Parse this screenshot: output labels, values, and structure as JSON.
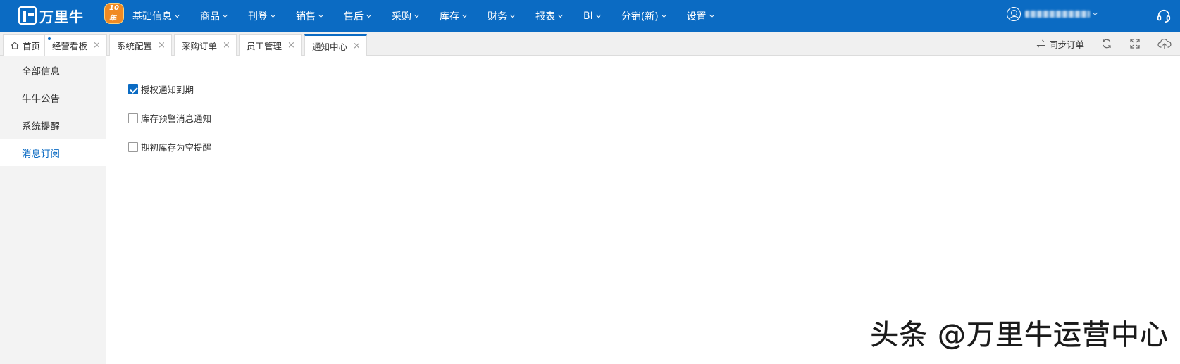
{
  "header": {
    "logo_text": "万里牛",
    "anniversary_badge": "10年",
    "nav": [
      {
        "label": "基础信息"
      },
      {
        "label": "商品"
      },
      {
        "label": "刊登"
      },
      {
        "label": "销售"
      },
      {
        "label": "售后"
      },
      {
        "label": "采购"
      },
      {
        "label": "库存"
      },
      {
        "label": "财务"
      },
      {
        "label": "报表"
      },
      {
        "label": "BI"
      },
      {
        "label": "分销(新)"
      },
      {
        "label": "设置"
      }
    ],
    "icons": {
      "user": "user-circle-icon",
      "support": "headset-icon"
    },
    "brand_color": "#0b6bc3"
  },
  "tabs": [
    {
      "label": "首页",
      "icon": "home-icon",
      "closable": false
    },
    {
      "label": "经营看板",
      "closable": true
    },
    {
      "label": "系统配置",
      "closable": true
    },
    {
      "label": "采购订单",
      "closable": true
    },
    {
      "label": "员工管理",
      "closable": true
    },
    {
      "label": "通知中心",
      "closable": true,
      "active": true
    }
  ],
  "tab_close_glyph": "×",
  "toolbar": {
    "sync_label": "同步订单",
    "icons": [
      "sync-icon",
      "refresh-icon",
      "fullscreen-icon",
      "cloud-upload-icon"
    ]
  },
  "sidebar": {
    "items": [
      {
        "label": "全部信息"
      },
      {
        "label": "牛牛公告"
      },
      {
        "label": "系统提醒"
      },
      {
        "label": "消息订阅",
        "active": true
      }
    ]
  },
  "subscriptions": [
    {
      "label": "授权通知到期",
      "checked": true
    },
    {
      "label": "库存预警消息通知",
      "checked": false
    },
    {
      "label": "期初库存为空提醒",
      "checked": false
    }
  ],
  "watermark": "头条 @万里牛运营中心"
}
